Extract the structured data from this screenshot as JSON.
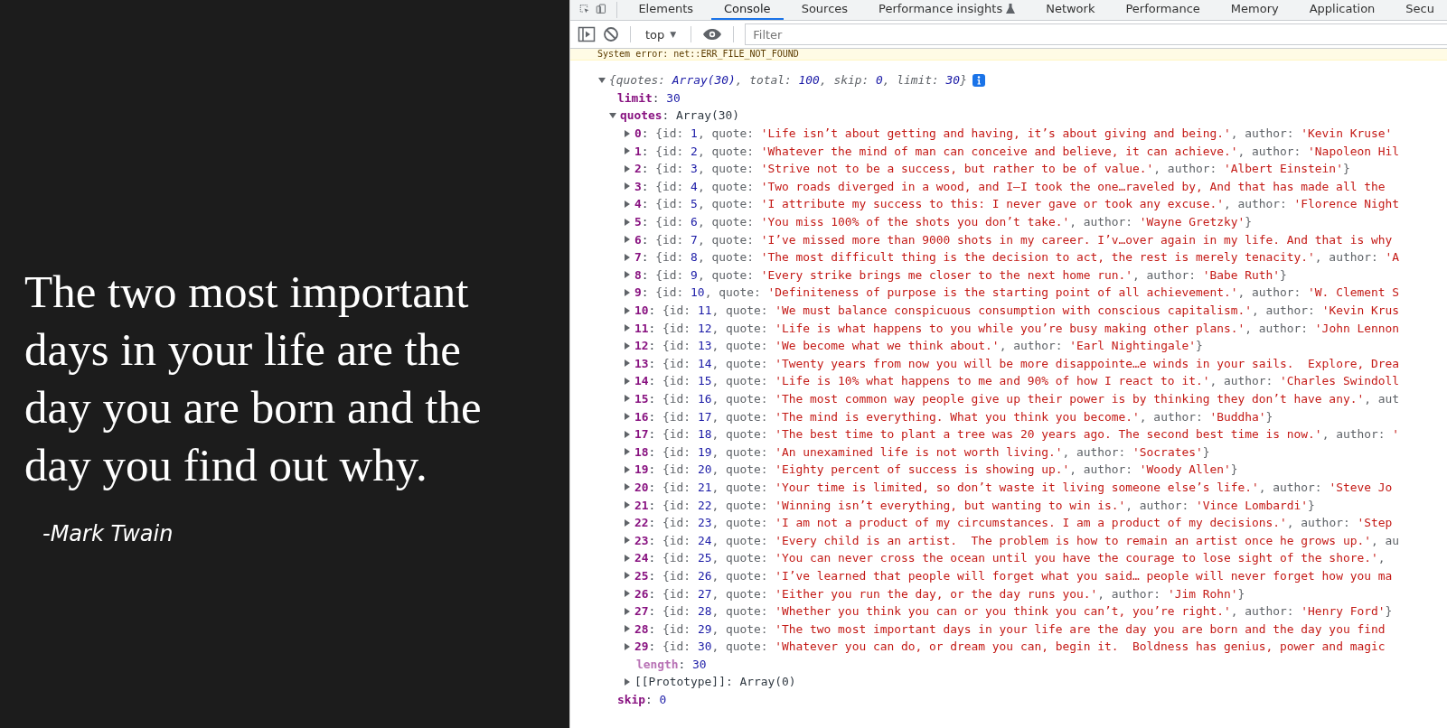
{
  "quote_panel": {
    "quote": "The two most important days in your life are the day you are born and the day you find out why.",
    "author": "-Mark Twain"
  },
  "devtools": {
    "tabs": [
      {
        "label": "Elements",
        "selected": false,
        "flask": false
      },
      {
        "label": "Console",
        "selected": true,
        "flask": false
      },
      {
        "label": "Sources",
        "selected": false,
        "flask": false
      },
      {
        "label": "Performance insights",
        "selected": false,
        "flask": true
      },
      {
        "label": "Network",
        "selected": false,
        "flask": false
      },
      {
        "label": "Performance",
        "selected": false,
        "flask": false
      },
      {
        "label": "Memory",
        "selected": false,
        "flask": false
      },
      {
        "label": "Application",
        "selected": false,
        "flask": false
      },
      {
        "label": "Secu",
        "selected": false,
        "flask": false
      }
    ],
    "toolbar": {
      "context": "top",
      "caret": "▼",
      "filter_placeholder": "Filter"
    },
    "warning": "System error: net::ERR_FILE_NOT_FOUND",
    "summary": [
      "{quotes: ",
      "Array(30)",
      ", total: ",
      "100",
      ", skip: ",
      "0",
      ", limit: ",
      "30",
      "}"
    ],
    "props_before": [
      {
        "key": "limit",
        "sep": ": ",
        "value": "30"
      }
    ],
    "array": {
      "key": "quotes",
      "sep": ": ",
      "value": "Array(30)",
      "expanded": true
    },
    "index_sep": ": ",
    "rows": [
      {
        "index": "0",
        "parts": [
          "{id: ",
          "1",
          ", quote: ",
          "'Life isn’t about getting and having, it’s about giving and being.'",
          ", author: ",
          "'Kevin Kruse'"
        ]
      },
      {
        "index": "1",
        "parts": [
          "{id: ",
          "2",
          ", quote: ",
          "'Whatever the mind of man can conceive and believe, it can achieve.'",
          ", author: ",
          "'Napoleon Hil"
        ]
      },
      {
        "index": "2",
        "parts": [
          "{id: ",
          "3",
          ", quote: ",
          "'Strive not to be a success, but rather to be of value.'",
          ", author: ",
          "'Albert Einstein'",
          "}"
        ]
      },
      {
        "index": "3",
        "parts": [
          "{id: ",
          "4",
          ", quote: ",
          "'Two roads diverged in a wood, and I—I took the one…raveled by, And that has made all the"
        ]
      },
      {
        "index": "4",
        "parts": [
          "{id: ",
          "5",
          ", quote: ",
          "'I attribute my success to this: I never gave or took any excuse.'",
          ", author: ",
          "'Florence Night"
        ]
      },
      {
        "index": "5",
        "parts": [
          "{id: ",
          "6",
          ", quote: ",
          "'You miss 100% of the shots you don’t take.'",
          ", author: ",
          "'Wayne Gretzky'",
          "}"
        ]
      },
      {
        "index": "6",
        "parts": [
          "{id: ",
          "7",
          ", quote: ",
          "'I’ve missed more than 9000 shots in my career. I’v…over again in my life. And that is why"
        ]
      },
      {
        "index": "7",
        "parts": [
          "{id: ",
          "8",
          ", quote: ",
          "'The most difficult thing is the decision to act, the rest is merely tenacity.'",
          ", author: ",
          "'A"
        ]
      },
      {
        "index": "8",
        "parts": [
          "{id: ",
          "9",
          ", quote: ",
          "'Every strike brings me closer to the next home run.'",
          ", author: ",
          "'Babe Ruth'",
          "}"
        ]
      },
      {
        "index": "9",
        "parts": [
          "{id: ",
          "10",
          ", quote: ",
          "'Definiteness of purpose is the starting point of all achievement.'",
          ", author: ",
          "'W. Clement S"
        ]
      },
      {
        "index": "10",
        "parts": [
          "{id: ",
          "11",
          ", quote: ",
          "'We must balance conspicuous consumption with conscious capitalism.'",
          ", author: ",
          "'Kevin Krus"
        ]
      },
      {
        "index": "11",
        "parts": [
          "{id: ",
          "12",
          ", quote: ",
          "'Life is what happens to you while you’re busy making other plans.'",
          ", author: ",
          "'John Lennon"
        ]
      },
      {
        "index": "12",
        "parts": [
          "{id: ",
          "13",
          ", quote: ",
          "'We become what we think about.'",
          ", author: ",
          "'Earl Nightingale'",
          "}"
        ]
      },
      {
        "index": "13",
        "parts": [
          "{id: ",
          "14",
          ", quote: ",
          "'Twenty years from now you will be more disappointe…e winds in your sails.  Explore, Drea"
        ]
      },
      {
        "index": "14",
        "parts": [
          "{id: ",
          "15",
          ", quote: ",
          "'Life is 10% what happens to me and 90% of how I react to it.'",
          ", author: ",
          "'Charles Swindoll"
        ]
      },
      {
        "index": "15",
        "parts": [
          "{id: ",
          "16",
          ", quote: ",
          "'The most common way people give up their power is by thinking they don’t have any.'",
          ", aut"
        ]
      },
      {
        "index": "16",
        "parts": [
          "{id: ",
          "17",
          ", quote: ",
          "'The mind is everything. What you think you become.'",
          ", author: ",
          "'Buddha'",
          "}"
        ]
      },
      {
        "index": "17",
        "parts": [
          "{id: ",
          "18",
          ", quote: ",
          "'The best time to plant a tree was 20 years ago. The second best time is now.'",
          ", author: ",
          "'"
        ]
      },
      {
        "index": "18",
        "parts": [
          "{id: ",
          "19",
          ", quote: ",
          "'An unexamined life is not worth living.'",
          ", author: ",
          "'Socrates'",
          "}"
        ]
      },
      {
        "index": "19",
        "parts": [
          "{id: ",
          "20",
          ", quote: ",
          "'Eighty percent of success is showing up.'",
          ", author: ",
          "'Woody Allen'",
          "}"
        ]
      },
      {
        "index": "20",
        "parts": [
          "{id: ",
          "21",
          ", quote: ",
          "'Your time is limited, so don’t waste it living someone else’s life.'",
          ", author: ",
          "'Steve Jo"
        ]
      },
      {
        "index": "21",
        "parts": [
          "{id: ",
          "22",
          ", quote: ",
          "'Winning isn’t everything, but wanting to win is.'",
          ", author: ",
          "'Vince Lombardi'",
          "}"
        ]
      },
      {
        "index": "22",
        "parts": [
          "{id: ",
          "23",
          ", quote: ",
          "'I am not a product of my circumstances. I am a product of my decisions.'",
          ", author: ",
          "'Step"
        ]
      },
      {
        "index": "23",
        "parts": [
          "{id: ",
          "24",
          ", quote: ",
          "'Every child is an artist.  The problem is how to remain an artist once he grows up.'",
          ", au"
        ]
      },
      {
        "index": "24",
        "parts": [
          "{id: ",
          "25",
          ", quote: ",
          "'You can never cross the ocean until you have the courage to lose sight of the shore.'",
          ","
        ]
      },
      {
        "index": "25",
        "parts": [
          "{id: ",
          "26",
          ", quote: ",
          "'I’ve learned that people will forget what you said… people will never forget how you ma"
        ]
      },
      {
        "index": "26",
        "parts": [
          "{id: ",
          "27",
          ", quote: ",
          "'Either you run the day, or the day runs you.'",
          ", author: ",
          "'Jim Rohn'",
          "}"
        ]
      },
      {
        "index": "27",
        "parts": [
          "{id: ",
          "28",
          ", quote: ",
          "'Whether you think you can or you think you can’t, you’re right.'",
          ", author: ",
          "'Henry Ford'",
          "}"
        ]
      },
      {
        "index": "28",
        "parts": [
          "{id: ",
          "29",
          ", quote: ",
          "'The two most important days in your life are the day you are born and the day you find"
        ]
      },
      {
        "index": "29",
        "parts": [
          "{id: ",
          "30",
          ", quote: ",
          "'Whatever you can do, or dream you can, begin it.  Boldness has genius, power and magic"
        ]
      }
    ],
    "length": {
      "key": "length",
      "sep": ": ",
      "value": "30"
    },
    "prototype": {
      "key": "[[Prototype]]",
      "sep": ": ",
      "value": "Array(0)",
      "expanded": false
    },
    "props_after": [
      {
        "key": "skip",
        "sep": ": ",
        "value": "0"
      }
    ]
  }
}
